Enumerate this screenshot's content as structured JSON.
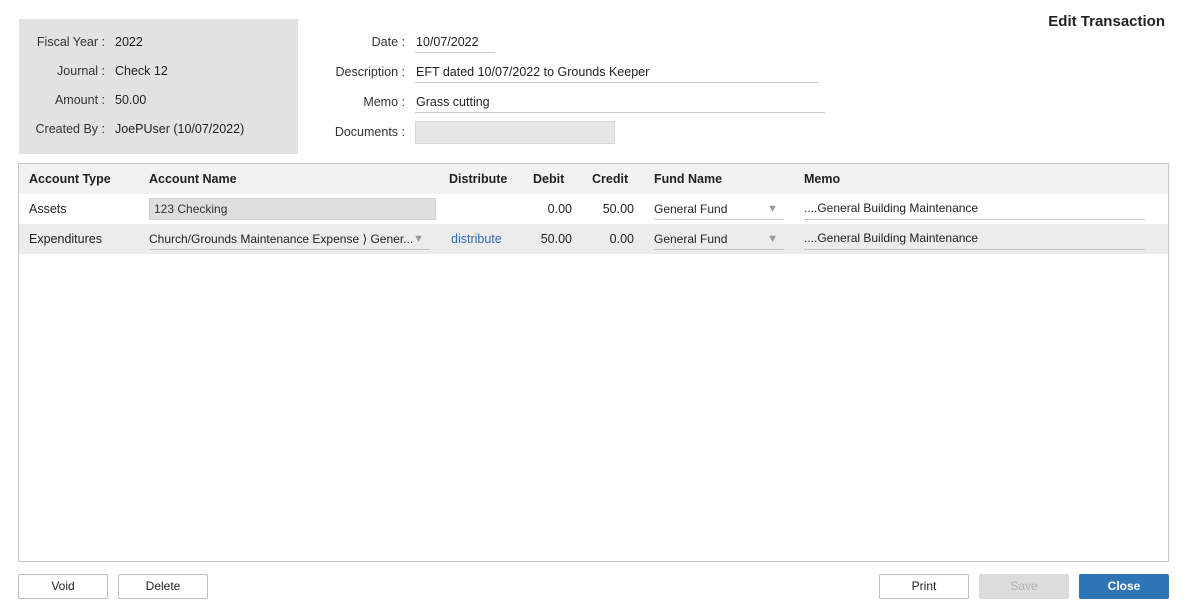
{
  "title": "Edit Transaction",
  "summary": {
    "fiscal_year_label": "Fiscal Year :",
    "fiscal_year": "2022",
    "journal_label": "Journal :",
    "journal": "Check 12",
    "amount_label": "Amount :",
    "amount": "50.00",
    "created_by_label": "Created By :",
    "created_by": "JoePUser (10/07/2022)"
  },
  "form": {
    "date_label": "Date :",
    "date": "10/07/2022",
    "description_label": "Description :",
    "description": "EFT dated 10/07/2022 to Grounds Keeper",
    "memo_label": "Memo :",
    "memo": "Grass cutting",
    "documents_label": "Documents :",
    "documents": ""
  },
  "grid": {
    "columns": [
      "Account Type",
      "Account Name",
      "Distribute",
      "Debit",
      "Credit",
      "Fund Name",
      "Memo"
    ],
    "rows": [
      {
        "account_type": "Assets",
        "account_name": "123 Checking",
        "distribute": "",
        "debit": "0.00",
        "credit": "50.00",
        "fund_name": "General Fund",
        "memo": "....General Building Maintenance"
      },
      {
        "account_type": "Expenditures",
        "account_name": "Church/Grounds Maintenance Expense ⟩ Gener...",
        "distribute": "distribute",
        "debit": "50.00",
        "credit": "0.00",
        "fund_name": "General Fund",
        "memo": "....General Building Maintenance"
      }
    ]
  },
  "icons": {
    "dropdown": "triangle-down-icon",
    "dropdown_glyph": "▼"
  },
  "buttons": {
    "void": "Void",
    "delete": "Delete",
    "print": "Print",
    "save": "Save",
    "close": "Close"
  },
  "colors": {
    "primary": "#2f74b5",
    "link": "#2a6cb5",
    "panel": "#e2e2e2"
  }
}
